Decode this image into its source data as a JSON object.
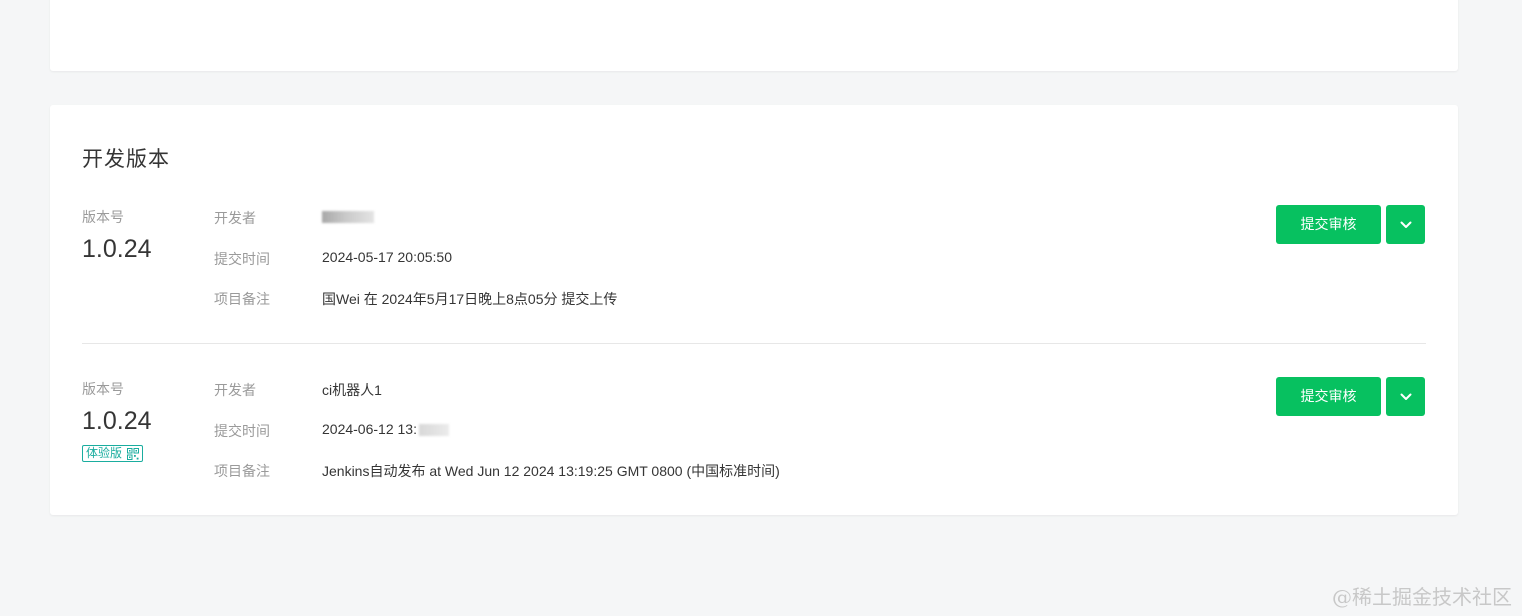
{
  "section": {
    "title": "开发版本"
  },
  "labels": {
    "version": "版本号",
    "developer": "开发者",
    "submit_time": "提交时间",
    "note": "项目备注",
    "submit_button": "提交审核"
  },
  "versions": [
    {
      "version": "1.0.24",
      "developer": "",
      "submit_time": "2024-05-17 20:05:50",
      "note": "国Wei 在 2024年5月17日晚上8点05分 提交上传",
      "badge": ""
    },
    {
      "version": "1.0.24",
      "developer": "ci机器人1",
      "submit_time": "2024-06-12 13:",
      "note": "Jenkins自动发布 at Wed Jun 12 2024 13:19:25 GMT 0800 (中国标准时间)",
      "badge": "体验版"
    }
  ],
  "watermark": "@稀土掘金技术社区",
  "icons": {
    "dropdown": "chevron-down-icon",
    "qr": "qr-code-icon"
  },
  "colors": {
    "primary_button": "#07c160",
    "badge": "#1aad9f",
    "page_background": "#f5f6f7"
  }
}
